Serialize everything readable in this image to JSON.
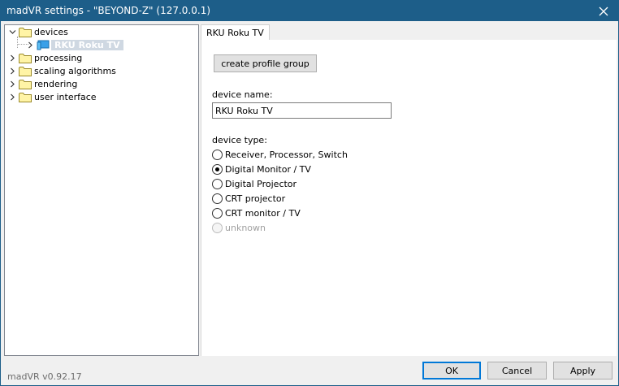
{
  "window": {
    "title": "madVR settings - \"BEYOND-Z\" (127.0.0.1)"
  },
  "tree": {
    "items": [
      {
        "label": "devices",
        "expanded": true
      },
      {
        "label": "RKU Roku TV",
        "selected": true
      },
      {
        "label": "processing"
      },
      {
        "label": "scaling algorithms"
      },
      {
        "label": "rendering"
      },
      {
        "label": "user interface"
      }
    ]
  },
  "tab": {
    "label": "RKU Roku TV"
  },
  "content": {
    "create_profile_group": "create profile group",
    "device_name_label": "device name:",
    "device_name_value": "RKU Roku TV",
    "device_type_label": "device type:",
    "device_types": [
      {
        "label": "Receiver, Processor, Switch",
        "checked": false,
        "enabled": true
      },
      {
        "label": "Digital Monitor / TV",
        "checked": true,
        "enabled": true
      },
      {
        "label": "Digital Projector",
        "checked": false,
        "enabled": true
      },
      {
        "label": "CRT projector",
        "checked": false,
        "enabled": true
      },
      {
        "label": "CRT monitor / TV",
        "checked": false,
        "enabled": true
      },
      {
        "label": "unknown",
        "checked": false,
        "enabled": false
      }
    ]
  },
  "footer": {
    "version": "madVR v0.92.17",
    "ok": "OK",
    "cancel": "Cancel",
    "apply": "Apply"
  },
  "colors": {
    "titlebar": "#1d5e89",
    "accent": "#0078d7"
  }
}
